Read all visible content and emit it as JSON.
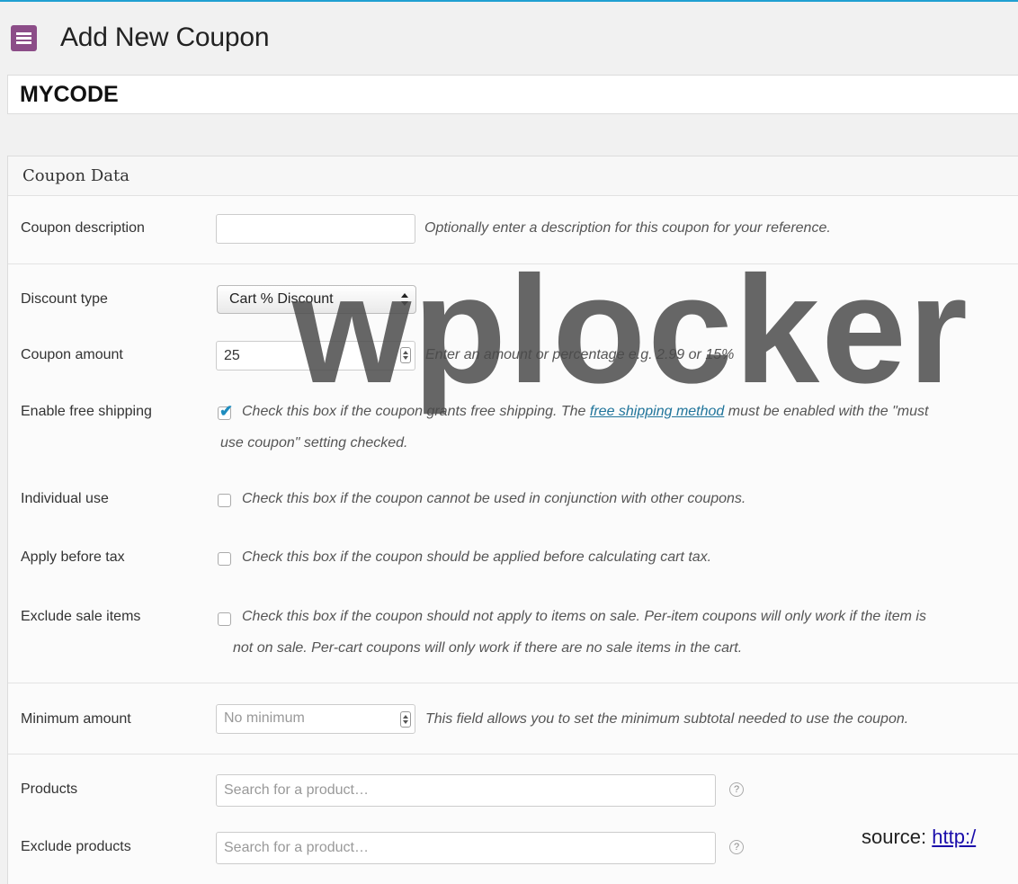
{
  "page": {
    "title": "Add New Coupon",
    "icon": "coupon-icon"
  },
  "coupon_code": "MYCODE",
  "panel": {
    "title": "Coupon Data"
  },
  "fields": {
    "description": {
      "label": "Coupon description",
      "value": "",
      "hint": "Optionally enter a description for this coupon for your reference."
    },
    "discount_type": {
      "label": "Discount type",
      "value": "Cart % Discount"
    },
    "amount": {
      "label": "Coupon amount",
      "value": "25",
      "hint": "Enter an amount or percentage e.g. 2.99 or 15%"
    },
    "free_shipping": {
      "label": "Enable free shipping",
      "checked": true,
      "hint_before": "Check this box if the coupon grants free shipping. The ",
      "link": "free shipping method",
      "hint_after": " must be enabled with the \"must",
      "hint_line2": "use coupon\" setting checked."
    },
    "individual_use": {
      "label": "Individual use",
      "checked": false,
      "hint": "Check this box if the coupon cannot be used in conjunction with other coupons."
    },
    "before_tax": {
      "label": "Apply before tax",
      "checked": false,
      "hint": "Check this box if the coupon should be applied before calculating cart tax."
    },
    "exclude_sale": {
      "label": "Exclude sale items",
      "checked": false,
      "hint_line1": "Check this box if the coupon should not apply to items on sale. Per-item coupons will only work if the item is",
      "hint_line2": "not on sale. Per-cart coupons will only work if there are no sale items in the cart."
    },
    "minimum_amount": {
      "label": "Minimum amount",
      "placeholder": "No minimum",
      "hint": "This field allows you to set the minimum subtotal needed to use the coupon."
    },
    "products": {
      "label": "Products",
      "placeholder": "Search for a product…"
    },
    "exclude_products": {
      "label": "Exclude products",
      "placeholder": "Search for a product…"
    }
  },
  "overlay": {
    "watermark": "wplocker",
    "source_prefix": "source: ",
    "source_link": "http:/"
  },
  "colors": {
    "accent": "#21a0d2",
    "icon_bg": "#8c4d88",
    "link": "#21759b",
    "checkmark": "#1e8cbe"
  }
}
